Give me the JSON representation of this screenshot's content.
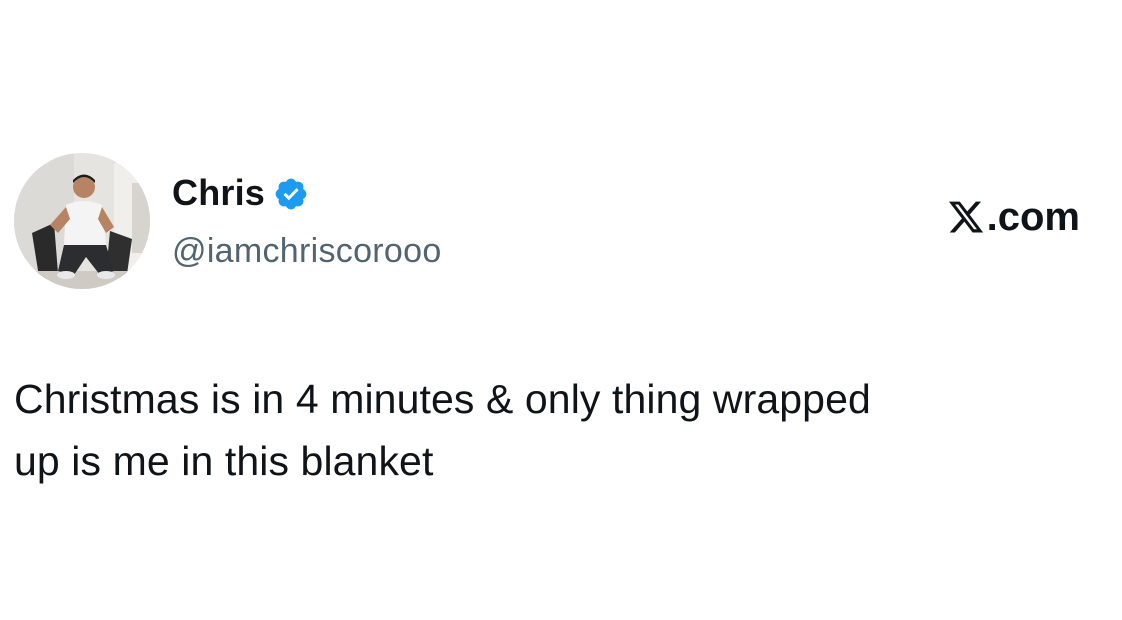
{
  "author": {
    "display_name": "Chris",
    "handle": "@iamchriscorooo",
    "verified": true,
    "avatar_icon": "avatar-photo"
  },
  "brand": {
    "logo_icon": "x-logo-icon",
    "suffix": ".com"
  },
  "tweet": {
    "text": "Christmas is in 4 minutes & only thing wrapped\nup is me in this blanket"
  },
  "colors": {
    "text_primary": "#0f1419",
    "text_secondary": "#536471",
    "verified_blue": "#1d9bf0",
    "background": "#ffffff"
  }
}
